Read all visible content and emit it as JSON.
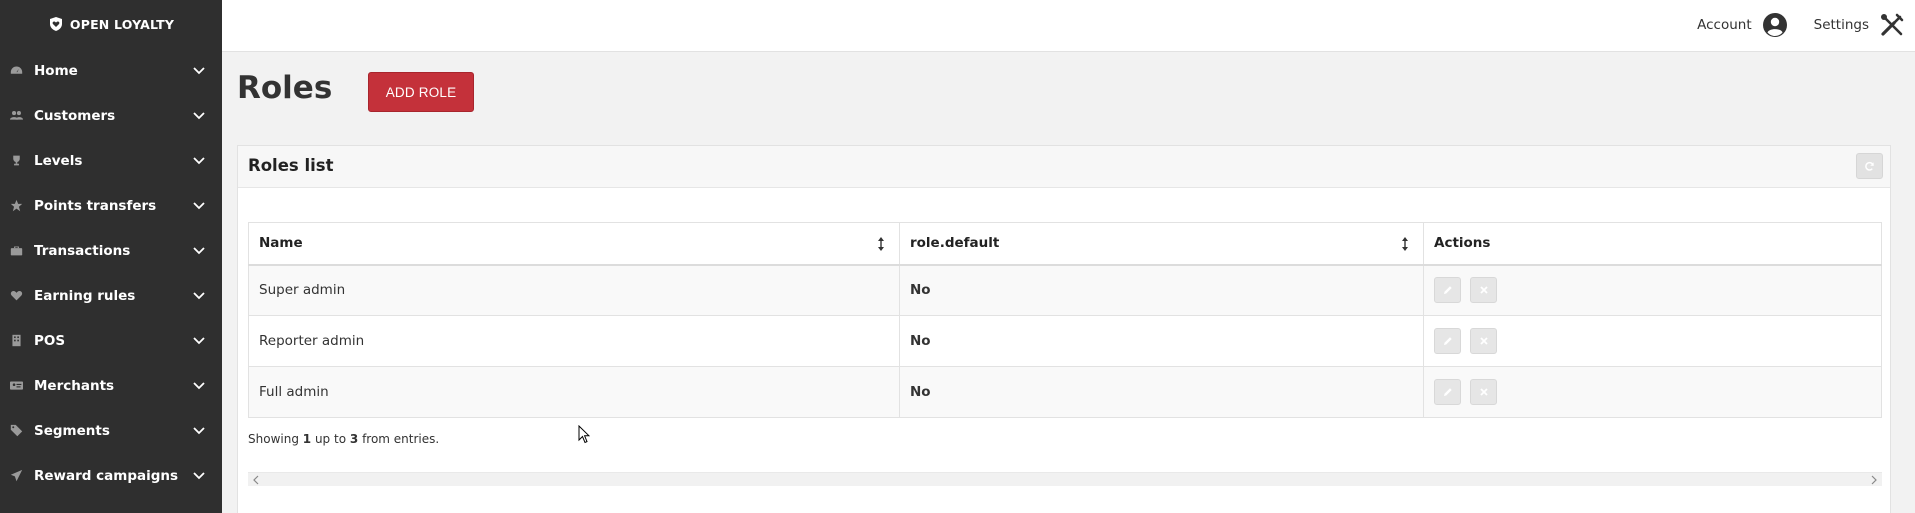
{
  "brand": {
    "name": "OPEN LOYALTY"
  },
  "sidebar": {
    "items": [
      {
        "label": "Home",
        "icon": "dashboard-icon"
      },
      {
        "label": "Customers",
        "icon": "users-icon"
      },
      {
        "label": "Levels",
        "icon": "trophy-icon"
      },
      {
        "label": "Points transfers",
        "icon": "star-icon"
      },
      {
        "label": "Transactions",
        "icon": "briefcase-icon"
      },
      {
        "label": "Earning rules",
        "icon": "heart-icon"
      },
      {
        "label": "POS",
        "icon": "building-icon"
      },
      {
        "label": "Merchants",
        "icon": "id-card-icon"
      },
      {
        "label": "Segments",
        "icon": "tags-icon"
      },
      {
        "label": "Reward campaigns",
        "icon": "send-icon"
      }
    ]
  },
  "header": {
    "account_label": "Account",
    "settings_label": "Settings"
  },
  "page": {
    "title": "Roles",
    "add_button": "ADD ROLE"
  },
  "panel": {
    "title": "Roles list",
    "columns": {
      "name": "Name",
      "default": "role.default",
      "actions": "Actions"
    },
    "rows": [
      {
        "name": "Super admin",
        "default": "No"
      },
      {
        "name": "Reporter admin",
        "default": "No"
      },
      {
        "name": "Full admin",
        "default": "No"
      }
    ],
    "footer": {
      "prefix": "Showing",
      "from": "1",
      "middle": "up to",
      "to": "3",
      "suffix": "from entries."
    }
  },
  "colors": {
    "sidebar_bg": "#2f2f2f",
    "accent": "#c4313a",
    "page_bg": "#f2f2f2"
  }
}
